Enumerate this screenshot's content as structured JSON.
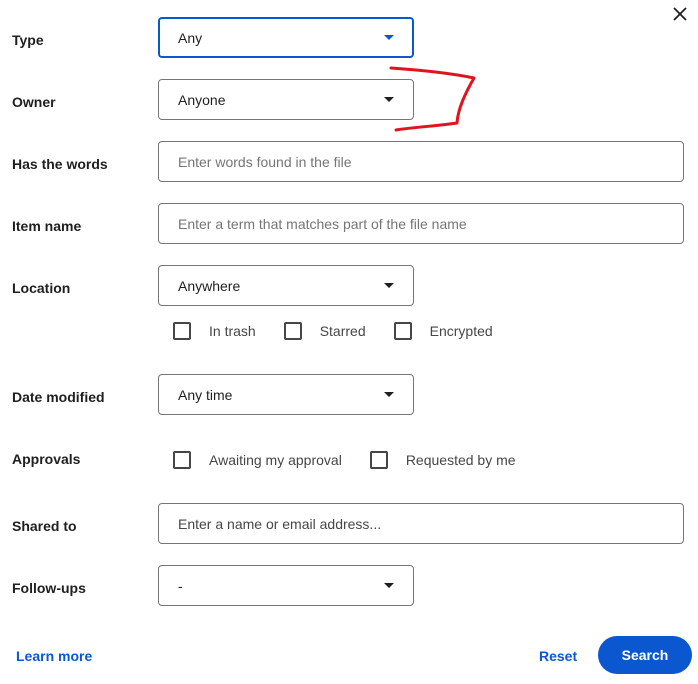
{
  "dialog": {
    "close_icon": "close-icon"
  },
  "fields": {
    "type": {
      "label": "Type",
      "value": "Any"
    },
    "owner": {
      "label": "Owner",
      "value": "Anyone"
    },
    "has_words": {
      "label": "Has the words",
      "value": "",
      "placeholder": "Enter words found in the file"
    },
    "item_name": {
      "label": "Item name",
      "value": "",
      "placeholder": "Enter a term that matches part of the file name"
    },
    "location": {
      "label": "Location",
      "value": "Anywhere",
      "options": [
        {
          "label": "In trash",
          "checked": false
        },
        {
          "label": "Starred",
          "checked": false
        },
        {
          "label": "Encrypted",
          "checked": false
        }
      ]
    },
    "date_modified": {
      "label": "Date modified",
      "value": "Any time"
    },
    "approvals": {
      "label": "Approvals",
      "options": [
        {
          "label": "Awaiting my approval",
          "checked": false
        },
        {
          "label": "Requested by me",
          "checked": false
        }
      ]
    },
    "shared_to": {
      "label": "Shared to",
      "value": "",
      "placeholder": "Enter a name or email address..."
    },
    "follow_ups": {
      "label": "Follow-ups",
      "value": "-"
    }
  },
  "footer": {
    "learn_more": "Learn more",
    "reset": "Reset",
    "search": "Search"
  },
  "colors": {
    "accent": "#0b57d0",
    "annotation": "#e0141e"
  },
  "annotation": {
    "type": "hand-drawn-bracket",
    "color": "#e0141e"
  }
}
